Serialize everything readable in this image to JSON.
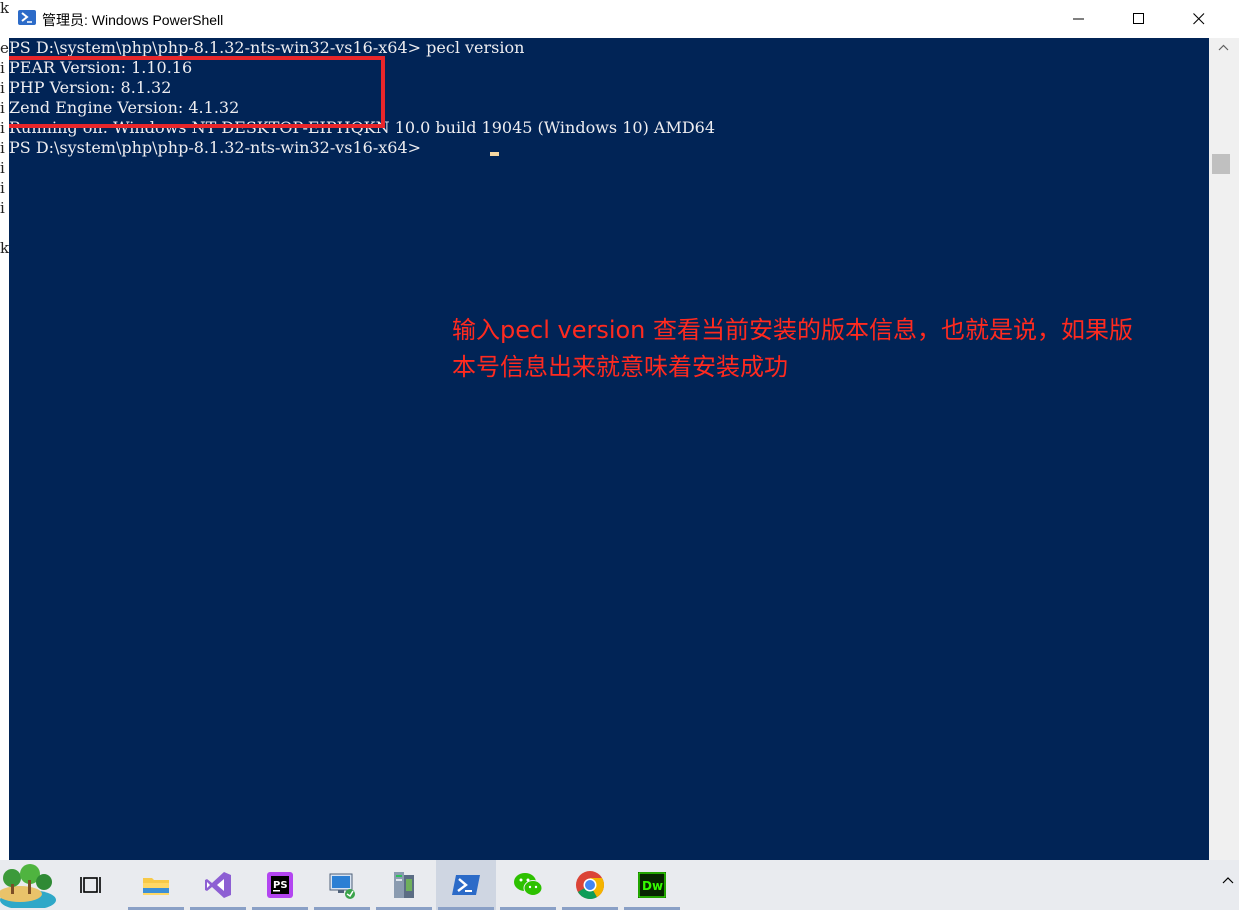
{
  "window": {
    "title": "管理员: Windows PowerShell",
    "background_color": "#012456",
    "controls": {
      "minimize": "minimize-icon",
      "maximize": "maximize-icon",
      "close": "close-icon"
    }
  },
  "background_window": {
    "visible_chars": [
      "k",
      "e",
      "i",
      "i",
      "i",
      "i",
      "i",
      "i",
      "i",
      "i",
      "k"
    ]
  },
  "console": {
    "lines": [
      "PS D:\\system\\php\\php-8.1.32-nts-win32-vs16-x64> pecl version",
      "PEAR Version: 1.10.16",
      "PHP Version: 8.1.32",
      "Zend Engine Version: 4.1.32",
      "Running on: Windows NT DESKTOP-EIPHQKN 10.0 build 19045 (Windows 10) AMD64",
      "PS D:\\system\\php\\php-8.1.32-nts-win32-vs16-x64> "
    ],
    "text_color": "#eeedf0",
    "cursor_color": "#f3d7a2"
  },
  "annotation": {
    "text": "输入pecl version 查看当前安装的版本信息，也就是说，如果版本号信息出来就意味着安装成功",
    "color": "#ff2a1f",
    "box_color": "#e8262a"
  },
  "taskbar": {
    "items": [
      {
        "name": "desktop-scene-icon",
        "active": false
      },
      {
        "name": "task-view-icon",
        "active": false
      },
      {
        "name": "file-explorer-icon",
        "active": false
      },
      {
        "name": "visual-studio-icon",
        "active": false
      },
      {
        "name": "phpstorm-icon",
        "active": false
      },
      {
        "name": "remote-desktop-icon",
        "active": false
      },
      {
        "name": "server-manager-icon",
        "active": false
      },
      {
        "name": "powershell-icon",
        "active": true
      },
      {
        "name": "wechat-icon",
        "active": false
      },
      {
        "name": "chrome-icon",
        "active": false
      },
      {
        "name": "dreamweaver-icon",
        "active": false
      }
    ],
    "tray": "chevron-up-icon",
    "labels": {
      "phpstorm": "PS",
      "dreamweaver": "Dw"
    }
  }
}
